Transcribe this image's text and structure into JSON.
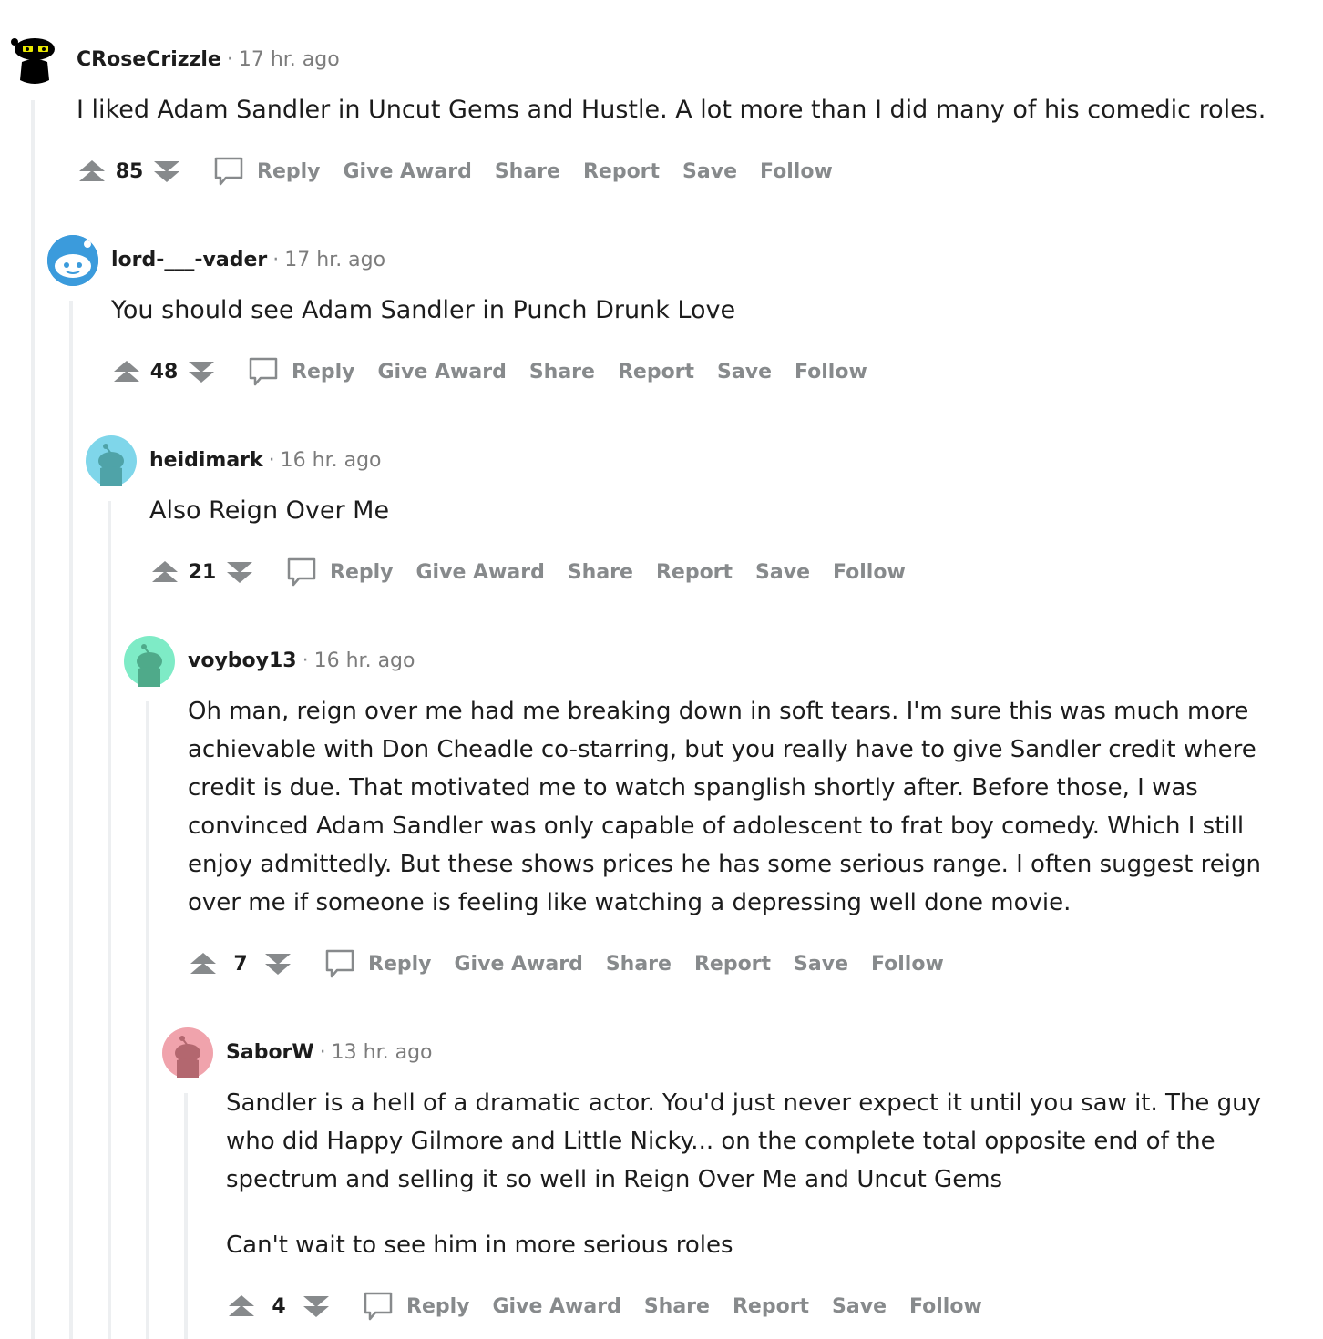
{
  "icons": {
    "upvote": "upvote-icon",
    "downvote": "downvote-icon",
    "reply": "speech-bubble-icon"
  },
  "colors": {
    "meta_gray": "#7c7c7c",
    "action_gray": "#878a8c",
    "thread_line": "#edeff1"
  },
  "comments": [
    {
      "author": "CRoseCrizzle",
      "time": "17 hr. ago",
      "body": [
        "I liked Adam Sandler in Uncut Gems and Hustle. A lot more than I did many of his comedic roles."
      ],
      "score": "85",
      "avatar_color": "#ffffff",
      "actions": {
        "reply": "Reply",
        "award": "Give Award",
        "share": "Share",
        "report": "Report",
        "save": "Save",
        "follow": "Follow"
      }
    },
    {
      "author": "lord-___-vader",
      "time": "17 hr. ago",
      "body": [
        "You should see Adam Sandler in Punch Drunk Love"
      ],
      "score": "48",
      "avatar_color": "#3b9bdc",
      "actions": {
        "reply": "Reply",
        "award": "Give Award",
        "share": "Share",
        "report": "Report",
        "save": "Save",
        "follow": "Follow"
      }
    },
    {
      "author": "heidimark",
      "time": "16 hr. ago",
      "body": [
        "Also Reign Over Me"
      ],
      "score": "21",
      "avatar_color": "#7fd6ea",
      "actions": {
        "reply": "Reply",
        "award": "Give Award",
        "share": "Share",
        "report": "Report",
        "save": "Save",
        "follow": "Follow"
      }
    },
    {
      "author": "voyboy13",
      "time": "16 hr. ago",
      "body": [
        "Oh man, reign over me had me breaking down in soft tears. I'm sure this was much more achievable with Don Cheadle co-starring, but you really have to give Sandler credit where credit is due. That motivated me to watch spanglish shortly after. Before those, I was convinced Adam Sandler was only capable of adolescent to frat boy comedy. Which I still enjoy admittedly. But these shows prices he has some serious range. I often suggest reign over me if someone is feeling like watching a depressing well done movie."
      ],
      "score": "7",
      "avatar_color": "#7eebc6",
      "actions": {
        "reply": "Reply",
        "award": "Give Award",
        "share": "Share",
        "report": "Report",
        "save": "Save",
        "follow": "Follow"
      }
    },
    {
      "author": "SaborW",
      "time": "13 hr. ago",
      "body": [
        "Sandler is a hell of a dramatic actor. You'd just never expect it until you saw it. The guy who did Happy Gilmore and Little Nicky... on the complete total opposite end of the spectrum and selling it so well in Reign Over Me and Uncut Gems",
        "Can't wait to see him in more serious roles"
      ],
      "score": "4",
      "avatar_color": "#f0a3ac",
      "actions": {
        "reply": "Reply",
        "award": "Give Award",
        "share": "Share",
        "report": "Report",
        "save": "Save",
        "follow": "Follow"
      }
    }
  ]
}
